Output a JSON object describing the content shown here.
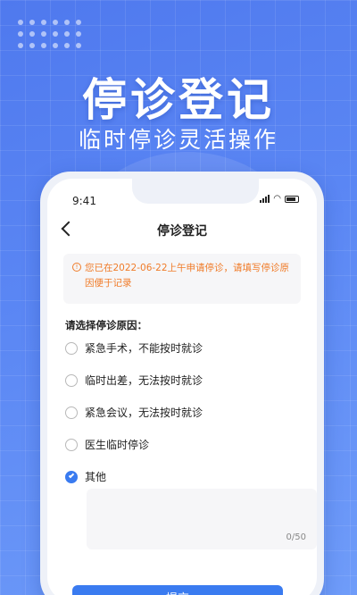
{
  "hero": {
    "title": "停诊登记",
    "subtitle": "临时停诊灵活操作"
  },
  "status_bar": {
    "time": "9:41"
  },
  "nav": {
    "title": "停诊登记"
  },
  "notice": {
    "text": "您已在2022-06-22上午申请停诊，请填写停诊原因便于记录"
  },
  "question": {
    "label": "请选择停诊原因："
  },
  "options": [
    {
      "label": "紧急手术，不能按时就诊",
      "checked": false
    },
    {
      "label": "临时出差，无法按时就诊",
      "checked": false
    },
    {
      "label": "紧急会议，无法按时就诊",
      "checked": false
    },
    {
      "label": "医生临时停诊",
      "checked": false
    },
    {
      "label": "其他",
      "checked": true
    }
  ],
  "textarea": {
    "counter": "0/50"
  },
  "submit": {
    "label": "提交"
  },
  "colors": {
    "accent": "#3a7bf0",
    "warning": "#f07b28",
    "background": "#5b87f4"
  }
}
